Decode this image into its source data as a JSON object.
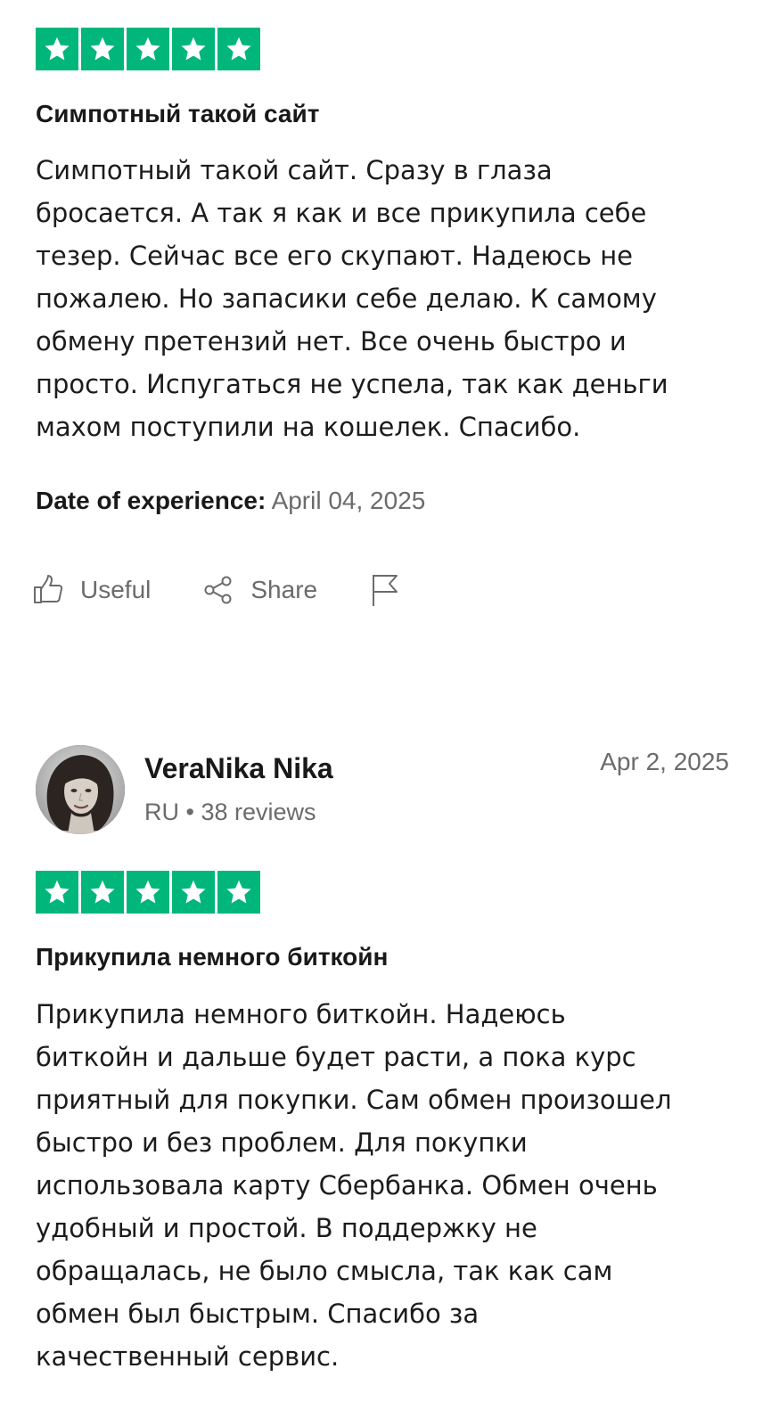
{
  "reviews": [
    {
      "rating": 5,
      "title": "Симпотный такой сайт",
      "lines": [
        "Симпотный такой сайт. Сразу в глаза",
        "бросается. А так я как и все прикупила себе",
        "тезер. Сейчас все его скупают. Надеюсь не",
        "пожалею. Но запасики себе делаю. К самому",
        "обмену претензий нет. Все очень быстро и",
        "просто. Испугаться не успела, так как деньги",
        "махом поступили на кошелек. Спасибо."
      ],
      "date_of_experience_label": "Date of experience:",
      "date_of_experience": "April 04, 2025",
      "actions": {
        "useful_label": "Useful",
        "share_label": "Share",
        "useful_icon": "thumbs-up-icon",
        "share_icon": "share-icon",
        "report_icon": "flag-icon"
      }
    },
    {
      "reviewer": {
        "name": "VeraNika Nika",
        "country": "RU",
        "separator": "•",
        "review_count": "38 reviews",
        "avatar": "avatar"
      },
      "date": "Apr 2, 2025",
      "rating": 5,
      "title": "Прикупила немного биткойн",
      "lines": [
        "Прикупила немного биткойн. Надеюсь",
        "биткойн и дальше будет расти, а пока курс",
        "приятный для покупки. Сам обмен произошел",
        "быстро и без проблем. Для покупки",
        "использовала карту Сбербанка. Обмен очень",
        "удобный и простой. В поддержку не",
        "обращалась, не было смысла, так как сам",
        "обмен был быстрым. Спасибо за",
        "качественный сервис."
      ]
    }
  ],
  "colors": {
    "star_green": "#00b67a",
    "text_primary": "#191919",
    "text_muted": "#6b6b6b"
  }
}
